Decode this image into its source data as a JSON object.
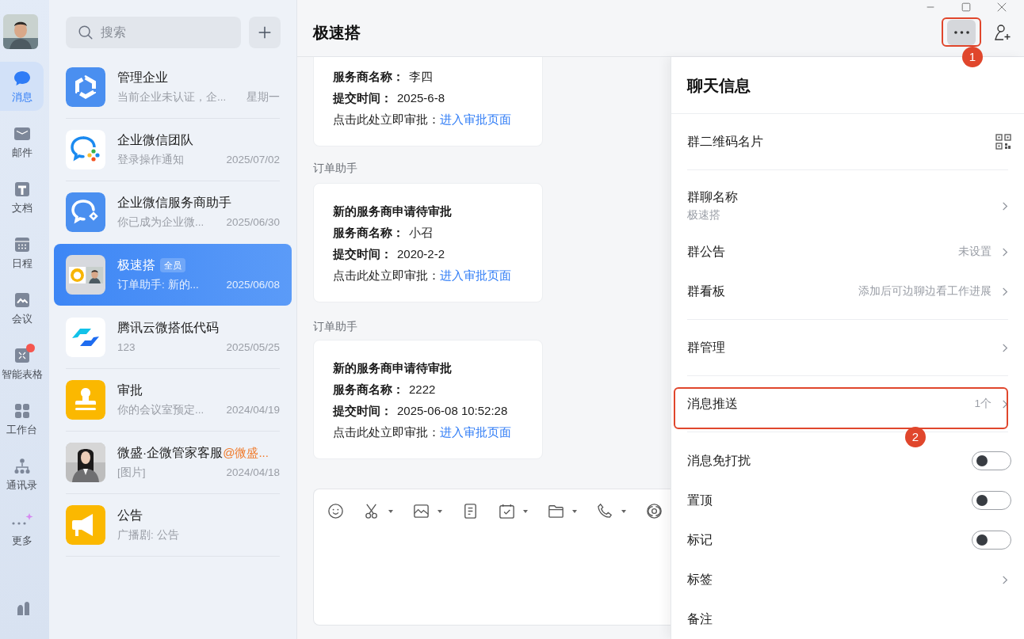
{
  "rail": {
    "items": [
      {
        "kind": "chat",
        "label": "消息",
        "selected": true,
        "badge": false
      },
      {
        "kind": "mail",
        "label": "邮件",
        "selected": false,
        "badge": false
      },
      {
        "kind": "doc",
        "label": "文档",
        "selected": false,
        "badge": false
      },
      {
        "kind": "calendar",
        "label": "日程",
        "selected": false,
        "badge": false
      },
      {
        "kind": "meeting",
        "label": "会议",
        "selected": false,
        "badge": false
      },
      {
        "kind": "sheet",
        "label": "智能表格",
        "selected": false,
        "badge": true
      },
      {
        "kind": "workbench",
        "label": "工作台",
        "selected": false,
        "badge": false
      },
      {
        "kind": "contacts",
        "label": "通讯录",
        "selected": false,
        "badge": false
      },
      {
        "kind": "more",
        "label": "更多",
        "selected": false,
        "badge": false
      }
    ]
  },
  "chat_list": {
    "search": {
      "placeholder": "搜索"
    },
    "items": [
      {
        "kind": "enterprise",
        "name": "管理企业",
        "preview": "当前企业未认证，企...",
        "time": "星期一",
        "selected": false
      },
      {
        "kind": "wecom-team",
        "name": "企业微信团队",
        "preview": "登录操作通知",
        "time": "2025/07/02",
        "selected": false
      },
      {
        "kind": "wecom-helper",
        "name": "企业微信服务商助手",
        "preview": "你已成为企业微...",
        "time": "2025/06/30",
        "selected": false
      },
      {
        "kind": "group",
        "name": "极速搭",
        "tag": "全员",
        "preview": "订单助手: 新的...",
        "time": "2025/06/08",
        "selected": true
      },
      {
        "kind": "weda",
        "name": "腾讯云微搭低代码",
        "preview": "123",
        "time": "2025/05/25",
        "selected": false
      },
      {
        "kind": "approval",
        "name": "审批",
        "preview": "你的会议室预定...",
        "time": "2024/04/19",
        "selected": false
      },
      {
        "kind": "person",
        "name": "微盛·企微管家客服",
        "mention": "@微盛...",
        "preview": "[图片]",
        "time": "2024/04/18",
        "selected": false
      },
      {
        "kind": "announce",
        "name": "公告",
        "preview": "广播剧: 公告",
        "selected": false
      }
    ]
  },
  "chat": {
    "title": "极速搭",
    "more_button": {
      "callout": "1"
    },
    "messages": [
      {
        "fields": [
          {
            "label": "服务商名称：",
            "value": "李四"
          },
          {
            "label": "提交时间：",
            "value": "2025-6-8"
          }
        ],
        "prompt": "点击此处立即审批：",
        "link": "进入审批页面"
      },
      {
        "sender": "订单助手",
        "title": "新的服务商申请待审批",
        "fields": [
          {
            "label": "服务商名称：",
            "value": "小召"
          },
          {
            "label": "提交时间：",
            "value": "2020-2-2"
          }
        ],
        "prompt": "点击此处立即审批：",
        "link": "进入审批页面"
      },
      {
        "sender": "订单助手",
        "title": "新的服务商申请待审批",
        "fields": [
          {
            "label": "服务商名称：",
            "value": "2222"
          },
          {
            "label": "提交时间：",
            "value": "2025-06-08 10:52:28"
          }
        ],
        "prompt": "点击此处立即审批：",
        "link": "进入审批页面"
      }
    ]
  },
  "info_panel": {
    "title": "聊天信息",
    "sections": [
      {
        "rows": [
          {
            "kind": "qr",
            "label": "群二维码名片"
          }
        ]
      },
      {
        "rows": [
          {
            "kind": "nav",
            "label": "群聊名称",
            "sub": "极速搭"
          },
          {
            "kind": "nav",
            "label": "群公告",
            "value": "未设置"
          },
          {
            "kind": "nav",
            "label": "群看板",
            "value": "添加后可边聊边看工作进展"
          }
        ]
      },
      {
        "rows": [
          {
            "kind": "nav",
            "label": "群管理"
          }
        ]
      },
      {
        "rows": [
          {
            "kind": "nav",
            "label": "消息推送",
            "value": "1个",
            "callout": "2"
          }
        ]
      },
      {
        "rows": [
          {
            "kind": "toggle",
            "label": "消息免打扰",
            "on": false
          },
          {
            "kind": "toggle",
            "label": "置顶",
            "on": false
          },
          {
            "kind": "toggle",
            "label": "标记",
            "on": false
          },
          {
            "kind": "nav",
            "label": "标签"
          },
          {
            "kind": "plain",
            "label": "备注"
          }
        ]
      }
    ]
  }
}
